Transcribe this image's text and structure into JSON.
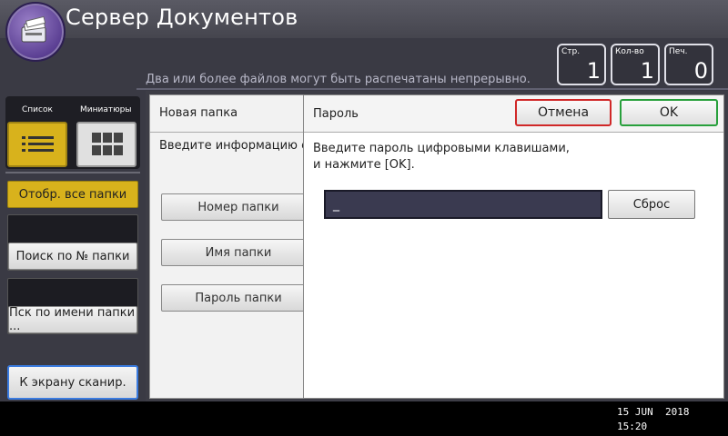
{
  "header": {
    "title": "Сервер Документов",
    "status_message": "Два или более файлов могут быть распечатаны непрерывно.",
    "counters": [
      {
        "label": "Стр.",
        "value": "1"
      },
      {
        "label": "Кол-во",
        "value": "1"
      },
      {
        "label": "Печ.",
        "value": "0"
      }
    ]
  },
  "sidebar": {
    "view_list_label": "Список",
    "view_thumbs_label": "Миниатюры",
    "show_all_folders": "Отобр. все папки",
    "search_by_number": "Поиск по № папки",
    "search_by_name": "Пск по имени папки ...",
    "to_scan_screen": "К экрану сканир."
  },
  "form": {
    "title": "Новая папка",
    "hint": "Введите информацию о",
    "folder_number": "Номер папки",
    "folder_name": "Имя папки",
    "folder_password": "Пароль папки"
  },
  "dialog": {
    "title": "Пароль",
    "cancel_label": "Отмена",
    "ok_label": "OK",
    "instruction_line1": "Введите пароль цифровыми клавишами,",
    "instruction_line2": "и нажмите [OK].",
    "password_value": "_",
    "reset_label": "Сброс"
  },
  "footer": {
    "date": "15 JUN  2018",
    "time": "15:20"
  },
  "colors": {
    "accent_yellow": "#d8b21c",
    "cancel_border": "#d02828",
    "ok_border": "#28a03c",
    "scan_border": "#3a7be0"
  },
  "icons": [
    "document-server-icon",
    "list-view-icon",
    "thumbnail-grid-icon"
  ]
}
